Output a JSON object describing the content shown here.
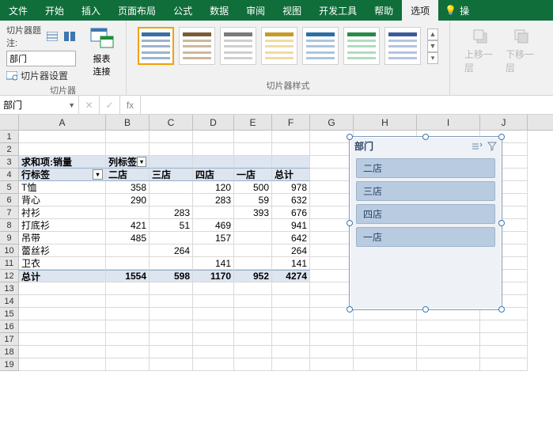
{
  "ribbon": {
    "tabs": [
      "文件",
      "开始",
      "插入",
      "页面布局",
      "公式",
      "数据",
      "审阅",
      "视图",
      "开发工具",
      "帮助",
      "选项"
    ],
    "active": 10,
    "tell_icon": "lightbulb-icon",
    "tell_text": "操"
  },
  "slicer_group": {
    "caption_label": "切片器题注:",
    "caption_value": "部门",
    "settings_label": "切片器设置",
    "connections_label": "报表\n连接",
    "group_label": "切片器"
  },
  "style_group": {
    "group_label": "切片器样式"
  },
  "arrange": {
    "bring_forward": "上移一层",
    "send_backward": "下移一层"
  },
  "namebox": "部门",
  "columns": [
    {
      "l": "A",
      "w": 110
    },
    {
      "l": "B",
      "w": 55
    },
    {
      "l": "C",
      "w": 55
    },
    {
      "l": "D",
      "w": 52
    },
    {
      "l": "E",
      "w": 48
    },
    {
      "l": "F",
      "w": 48
    },
    {
      "l": "G",
      "w": 55
    },
    {
      "l": "H",
      "w": 80
    },
    {
      "l": "I",
      "w": 80
    },
    {
      "l": "J",
      "w": 60
    }
  ],
  "pivot": {
    "sum_label": "求和项:销量",
    "col_axis": "列标签",
    "row_axis": "行标签",
    "cols": [
      "二店",
      "三店",
      "四店",
      "一店",
      "总计"
    ],
    "rows": [
      {
        "label": "T恤",
        "v": [
          "358",
          "",
          "120",
          "500",
          "978"
        ]
      },
      {
        "label": "背心",
        "v": [
          "290",
          "",
          "283",
          "59",
          "632"
        ]
      },
      {
        "label": "衬衫",
        "v": [
          "",
          "283",
          "",
          "393",
          "676"
        ]
      },
      {
        "label": "打底衫",
        "v": [
          "421",
          "51",
          "469",
          "",
          "941"
        ]
      },
      {
        "label": "吊带",
        "v": [
          "485",
          "",
          "157",
          "",
          "642"
        ]
      },
      {
        "label": "蕾丝衫",
        "v": [
          "",
          "264",
          "",
          "",
          "264"
        ]
      },
      {
        "label": "卫衣",
        "v": [
          "",
          "",
          "141",
          "",
          "141"
        ]
      }
    ],
    "total_label": "总计",
    "totals": [
      "1554",
      "598",
      "1170",
      "952",
      "4274"
    ]
  },
  "slicer": {
    "title": "部门",
    "items": [
      "二店",
      "三店",
      "四店",
      "一店"
    ]
  },
  "chart_data": {
    "type": "table",
    "title": "求和项:销量",
    "categories": [
      "二店",
      "三店",
      "四店",
      "一店",
      "总计"
    ],
    "series": [
      {
        "name": "T恤",
        "values": [
          358,
          null,
          120,
          500,
          978
        ]
      },
      {
        "name": "背心",
        "values": [
          290,
          null,
          283,
          59,
          632
        ]
      },
      {
        "name": "衬衫",
        "values": [
          null,
          283,
          null,
          393,
          676
        ]
      },
      {
        "name": "打底衫",
        "values": [
          421,
          51,
          469,
          null,
          941
        ]
      },
      {
        "name": "吊带",
        "values": [
          485,
          null,
          157,
          null,
          642
        ]
      },
      {
        "name": "蕾丝衫",
        "values": [
          null,
          264,
          null,
          null,
          264
        ]
      },
      {
        "name": "卫衣",
        "values": [
          null,
          null,
          141,
          null,
          141
        ]
      },
      {
        "name": "总计",
        "values": [
          1554,
          598,
          1170,
          952,
          4274
        ]
      }
    ]
  }
}
